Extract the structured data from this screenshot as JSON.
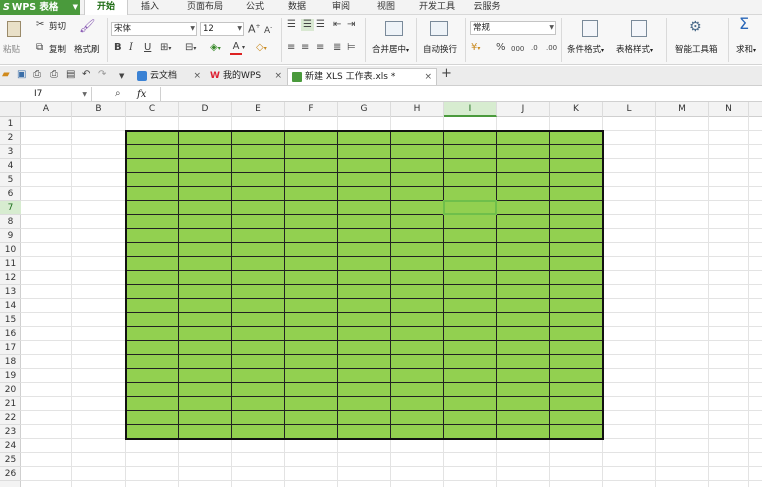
{
  "app": {
    "logo": "WPS 表格"
  },
  "menu": {
    "tabs": [
      "开始",
      "插入",
      "页面布局",
      "公式",
      "数据",
      "审阅",
      "视图",
      "开发工具",
      "云服务"
    ],
    "active": 0
  },
  "ribbon": {
    "paste": "粘贴",
    "cut": "剪切",
    "copy": "复制",
    "format_painter": "格式刷",
    "font_name": "宋体",
    "font_size": "12",
    "bold": "B",
    "italic": "I",
    "underline": "U",
    "number_format": "常规",
    "merge_center": "合并居中",
    "wrap_text": "自动换行",
    "conditional_format": "条件格式",
    "table_style": "表格样式",
    "smart_toolbox": "智能工具箱",
    "sum": "求和",
    "percent": "%",
    "thousands": "000"
  },
  "doc_tabs": [
    {
      "label": "云文档"
    },
    {
      "label": "我的WPS"
    },
    {
      "label": "新建 XLS 工作表.xls *"
    }
  ],
  "formula_bar": {
    "cell_ref": "I7",
    "fx": "fx",
    "value": ""
  },
  "grid": {
    "columns": [
      "A",
      "B",
      "C",
      "D",
      "E",
      "F",
      "G",
      "H",
      "I",
      "J",
      "K",
      "L",
      "M",
      "N"
    ],
    "rows": [
      "1",
      "2",
      "3",
      "4",
      "5",
      "6",
      "7",
      "8",
      "9",
      "10",
      "11",
      "12",
      "13",
      "14",
      "15",
      "16",
      "17",
      "18",
      "19",
      "20",
      "21",
      "22",
      "23",
      "24",
      "25",
      "26"
    ],
    "selected_col": "I",
    "selected_row": "7",
    "filled_range": {
      "from": "C2",
      "to": "K23",
      "fill_color": "#92d050"
    }
  }
}
